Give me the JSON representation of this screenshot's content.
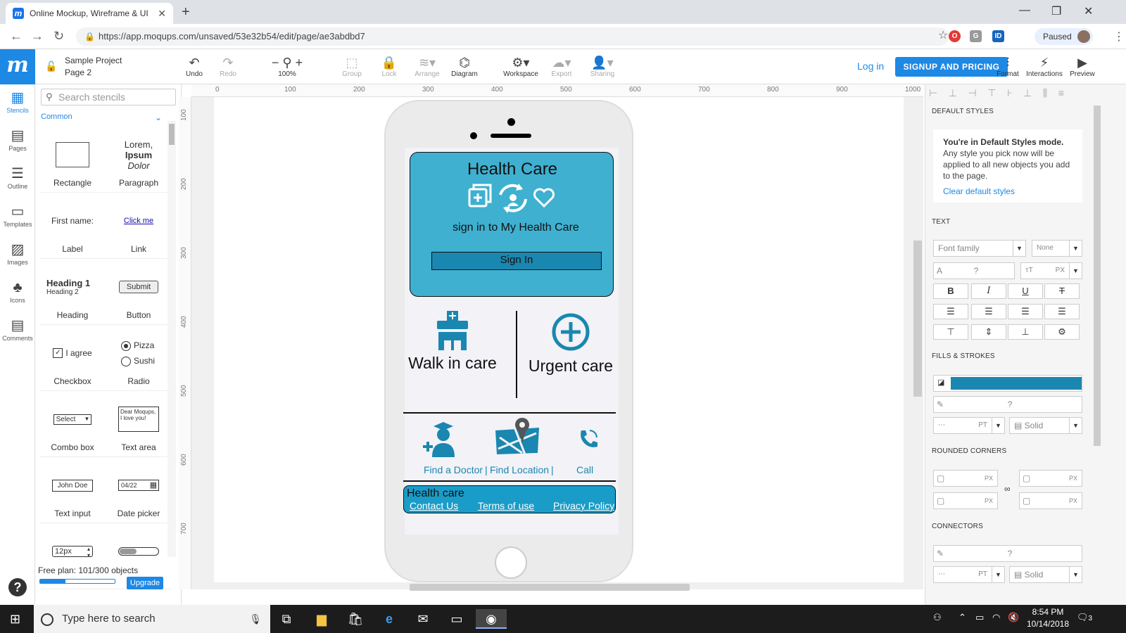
{
  "browser": {
    "tab_title": "Online Mockup, Wireframe & UI",
    "url": "https://app.moqups.com/unsaved/53e32b54/edit/page/ae3abdbd7",
    "profile_status": "Paused"
  },
  "app": {
    "logo": "m",
    "project": {
      "name": "Sample Project",
      "page": "Page 2"
    },
    "toolbar": [
      {
        "label": "Undo",
        "icon": "undo-icon",
        "glyph": "↶"
      },
      {
        "label": "Redo",
        "icon": "redo-icon",
        "glyph": "↷"
      },
      {
        "label": "100%",
        "icon": "zoom-icon",
        "glyph": "− ⚲ +"
      },
      {
        "label": "Group",
        "icon": "group-icon",
        "glyph": "⬚"
      },
      {
        "label": "Lock",
        "icon": "lock-icon",
        "glyph": "🔒"
      },
      {
        "label": "Arrange",
        "icon": "arrange-icon",
        "glyph": "≋"
      },
      {
        "label": "Diagram",
        "icon": "diagram-icon",
        "glyph": "⌬"
      },
      {
        "label": "Workspace",
        "icon": "workspace-icon",
        "glyph": "⚙"
      },
      {
        "label": "Export",
        "icon": "export-icon",
        "glyph": "☁"
      },
      {
        "label": "Sharing",
        "icon": "sharing-icon",
        "glyph": "👤"
      }
    ],
    "login": "Log in",
    "signup": "SIGNUP AND PRICING",
    "right_tools": [
      {
        "label": "Format",
        "glyph": "⫶"
      },
      {
        "label": "Interactions",
        "glyph": "⚡"
      },
      {
        "label": "Preview",
        "glyph": "▶"
      }
    ]
  },
  "rail": [
    {
      "label": "Stencils",
      "glyph": "▦"
    },
    {
      "label": "Pages",
      "glyph": "▤"
    },
    {
      "label": "Outline",
      "glyph": "☰"
    },
    {
      "label": "Templates",
      "glyph": "▭"
    },
    {
      "label": "Images",
      "glyph": "🖼"
    },
    {
      "label": "Icons",
      "glyph": "♣"
    },
    {
      "label": "Comments",
      "glyph": "💬"
    }
  ],
  "stencils": {
    "search_placeholder": "Search stencils",
    "category": "Common",
    "items": [
      {
        "label": "Rectangle"
      },
      {
        "label": "Paragraph",
        "preview": [
          "Lorem,",
          "Ipsum",
          "Dolor"
        ]
      },
      {
        "label": "Label",
        "preview": "First name:"
      },
      {
        "label": "Link",
        "preview": "Click me"
      },
      {
        "label": "Heading",
        "preview": [
          "Heading 1",
          "Heading 2"
        ]
      },
      {
        "label": "Button",
        "preview": "Submit"
      },
      {
        "label": "Checkbox",
        "preview": "I agree"
      },
      {
        "label": "Radio",
        "preview": [
          "Pizza",
          "Sushi"
        ]
      },
      {
        "label": "Combo box",
        "preview": "Select"
      },
      {
        "label": "Text area",
        "preview": "Dear Moqups, I love you!"
      },
      {
        "label": "Text input",
        "preview": "John Doe"
      },
      {
        "label": "Date picker",
        "preview": "04/22"
      },
      {
        "label": "",
        "preview": "12px"
      },
      {
        "label": "",
        "preview": ""
      }
    ],
    "plan_text": "Free plan: 101/300 objects",
    "plan_used": 101,
    "plan_total": 300,
    "upgrade": "Upgrade"
  },
  "ruler": {
    "top": [
      "0",
      "100",
      "200",
      "300",
      "400",
      "500",
      "600",
      "700",
      "800",
      "900",
      "1000"
    ],
    "left": [
      "100",
      "200",
      "300",
      "400",
      "500",
      "600",
      "700"
    ]
  },
  "mockup": {
    "hero_title": "Health Care",
    "hero_subtitle": "sign in to My Health Care",
    "sign_in": "Sign In",
    "walk_in": "Walk in care",
    "urgent": "Urgent care",
    "find_doctor": "Find a Doctor",
    "find_location": "Find Location",
    "call": "Call",
    "sep1": "|",
    "sep2": "|",
    "footer_title": "Health care",
    "footer_links": [
      "Contact Us",
      "Terms of use",
      "Privacy Policy"
    ],
    "colors": {
      "hero": "#3fb0d0",
      "button": "#1a87b0",
      "footer": "#1a9cc8"
    }
  },
  "format_panel": {
    "default_styles_head": "DEFAULT STYLES",
    "ds_title": "You're in Default Styles mode.",
    "ds_body": "Any style you pick now will be applied to all new objects you add to the page.",
    "ds_clear": "Clear default styles",
    "text_head": "TEXT",
    "font_family": "Font family",
    "font_none": "None",
    "unknown": "?",
    "px": "PX",
    "pt": "PT",
    "fills_head": "FILLS & STROKES",
    "stroke_style": "Solid",
    "corners_head": "ROUNDED CORNERS",
    "connectors_head": "CONNECTORS",
    "fill_color": "#1a87b0"
  },
  "taskbar": {
    "search": "Type here to search",
    "time": "8:54 PM",
    "date": "10/14/2018",
    "notifications": "3"
  }
}
